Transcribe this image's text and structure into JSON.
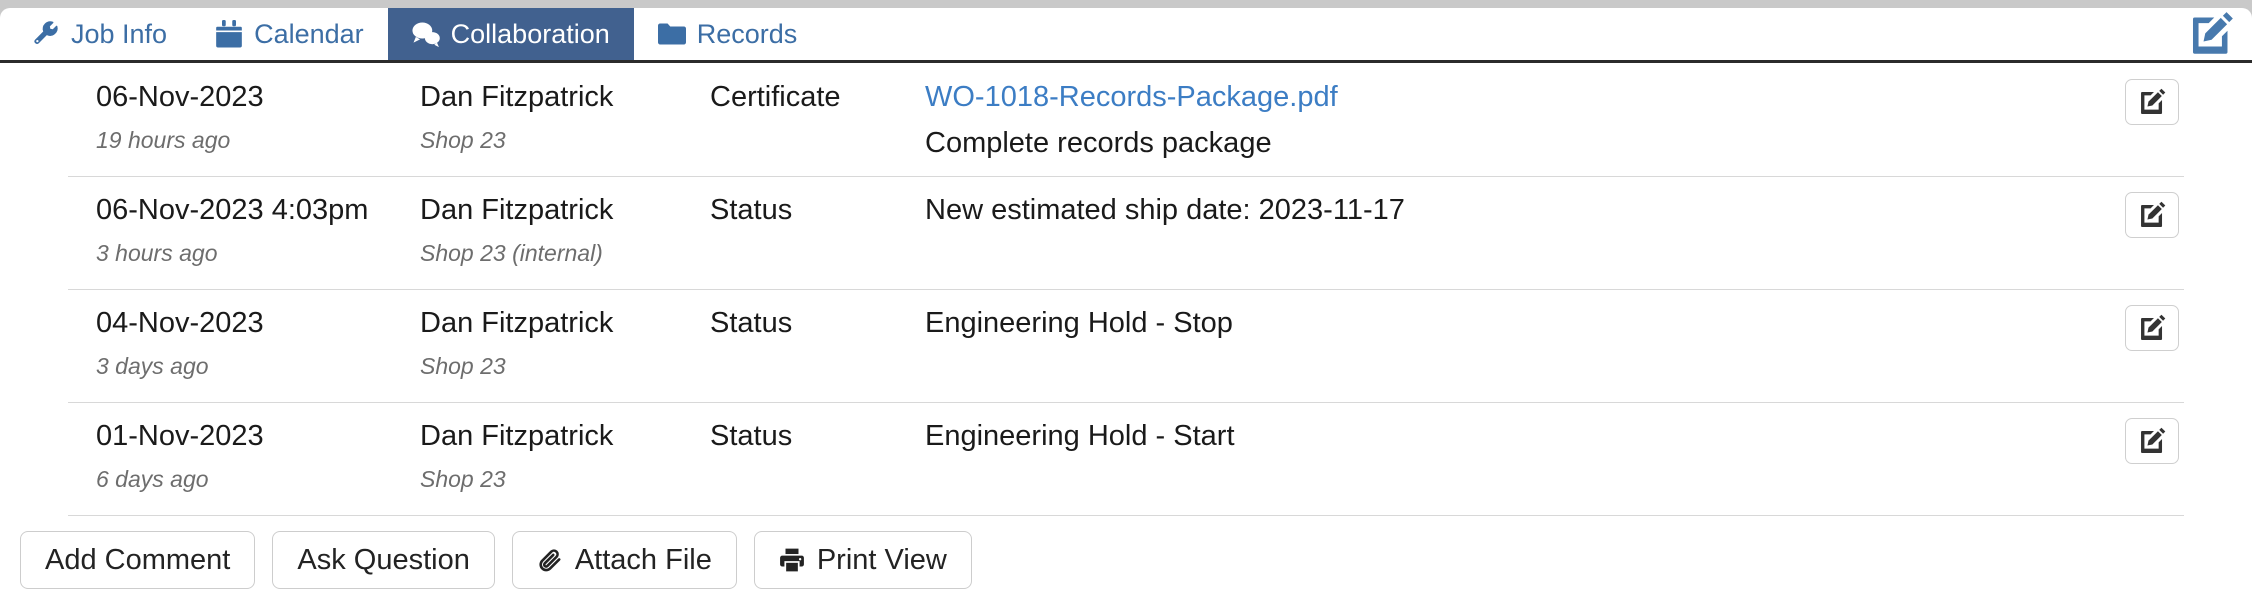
{
  "tabs": [
    {
      "id": "job-info",
      "label": "Job Info",
      "icon": "wrench-icon",
      "active": false
    },
    {
      "id": "calendar",
      "label": "Calendar",
      "icon": "calendar-icon",
      "active": false
    },
    {
      "id": "collaboration",
      "label": "Collaboration",
      "icon": "comments-icon",
      "active": true
    },
    {
      "id": "records",
      "label": "Records",
      "icon": "folder-icon",
      "active": false
    }
  ],
  "header": {
    "edit_icon": "pen-to-square-icon"
  },
  "rows": [
    {
      "date": "06-Nov-2023",
      "relative": "19 hours ago",
      "user": "Dan Fitzpatrick",
      "shop": "Shop 23",
      "type": "Certificate",
      "detail_link": "WO-1018-Records-Package.pdf",
      "detail_text": "Complete records package",
      "action_icon": "pen-to-square-icon"
    },
    {
      "date": "06-Nov-2023 4:03pm",
      "relative": "3 hours ago",
      "user": "Dan Fitzpatrick",
      "shop": "Shop 23 (internal)",
      "type": "Status",
      "detail_link": "",
      "detail_text": "New estimated ship date: 2023-11-17",
      "action_icon": "pen-to-square-icon"
    },
    {
      "date": "04-Nov-2023",
      "relative": "3 days ago",
      "user": "Dan Fitzpatrick",
      "shop": "Shop 23",
      "type": "Status",
      "detail_link": "",
      "detail_text": "Engineering Hold - Stop",
      "action_icon": "pen-to-square-icon"
    },
    {
      "date": "01-Nov-2023",
      "relative": "6 days ago",
      "user": "Dan Fitzpatrick",
      "shop": "Shop 23",
      "type": "Status",
      "detail_link": "",
      "detail_text": "Engineering Hold - Start",
      "action_icon": "pen-to-square-icon"
    }
  ],
  "footer": {
    "buttons": [
      {
        "id": "add-comment",
        "label": "Add Comment",
        "icon": ""
      },
      {
        "id": "ask-question",
        "label": "Ask Question",
        "icon": ""
      },
      {
        "id": "attach-file",
        "label": "Attach File",
        "icon": "paperclip-icon"
      },
      {
        "id": "print-view",
        "label": "Print View",
        "icon": "printer-icon"
      }
    ]
  },
  "colors": {
    "tab_link": "#3c6ea5",
    "tab_active_bg": "#41618f",
    "file_link": "#3c7dc4",
    "page_bg": "#c9c9c9"
  }
}
